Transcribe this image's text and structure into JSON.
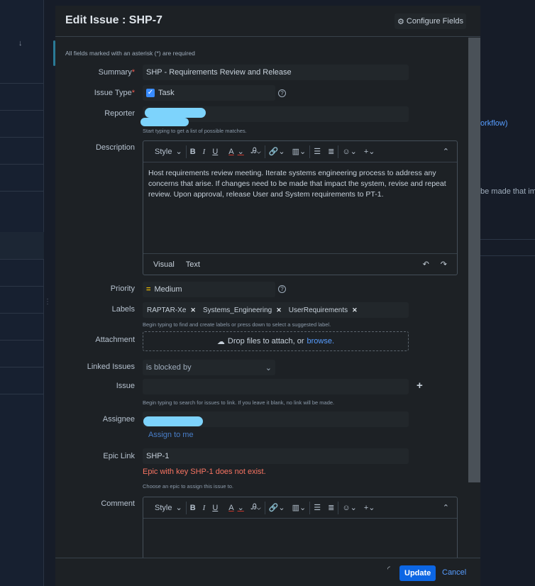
{
  "background": {
    "link_text": "orkflow)",
    "text_fragment": "be made that imp"
  },
  "modal": {
    "title": "Edit Issue : SHP-7",
    "configure_fields": "Configure Fields",
    "required_note": "All fields marked with an asterisk (*) are required",
    "fields": {
      "summary": {
        "label": "Summary",
        "value": "SHP - Requirements Review and Release"
      },
      "issue_type": {
        "label": "Issue Type",
        "value": "Task"
      },
      "reporter": {
        "label": "Reporter",
        "hint": "Start typing to get a list of possible matches."
      },
      "description": {
        "label": "Description",
        "value": "Host requirements review meeting. Iterate systems engineering process to address any concerns that arise. If changes need to be made that impact the system, revise and repeat review. Upon approval, release User and System requirements to PT-1."
      },
      "priority": {
        "label": "Priority",
        "value": "Medium"
      },
      "labels": {
        "label": "Labels",
        "tags": [
          "RAPTAR-Xe",
          "Systems_Engineering",
          "UserRequirements"
        ],
        "hint": "Begin typing to find and create labels or press down to select a suggested label."
      },
      "attachment": {
        "label": "Attachment",
        "drop_text": "Drop files to attach, or",
        "browse": "browse."
      },
      "linked_issues": {
        "label": "Linked Issues",
        "value": "is blocked by"
      },
      "issue": {
        "label": "Issue",
        "hint": "Begin typing to search for issues to link. If you leave it blank, no link will be made."
      },
      "assignee": {
        "label": "Assignee",
        "assign_to_me": "Assign to me"
      },
      "epic_link": {
        "label": "Epic Link",
        "value": "SHP-1",
        "error": "Epic with key SHP-1 does not exist.",
        "hint": "Choose an epic to assign this issue to."
      },
      "comment": {
        "label": "Comment"
      }
    },
    "editor": {
      "style": "Style",
      "bold": "B",
      "italic": "I",
      "underline": "U",
      "color": "A",
      "tab_visual": "Visual",
      "tab_text": "Text"
    },
    "footer": {
      "update": "Update",
      "cancel": "Cancel"
    }
  }
}
